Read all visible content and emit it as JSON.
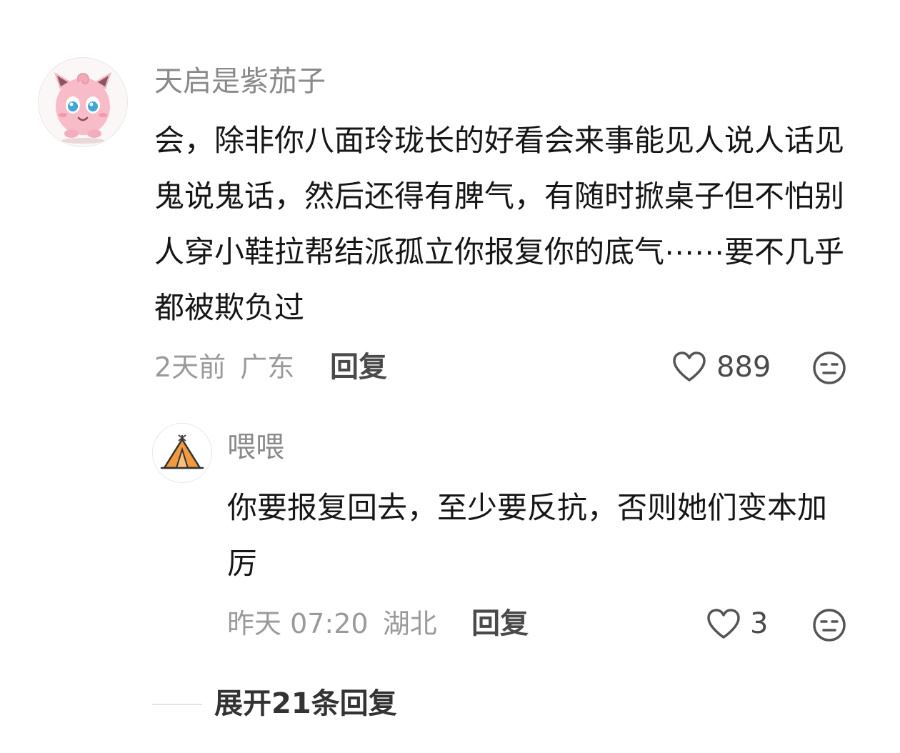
{
  "comment": {
    "username": "天启是紫茄子",
    "content": "会，除非你八面玲珑长的好看会来事能见人说人话见鬼说鬼话，然后还得有脾气，有随时掀桌子但不怕别人穿小鞋拉帮结派孤立你报复你的底气⋯⋯要不几乎都被欺负过",
    "time": "2天前",
    "location": "广东",
    "reply_label": "回复",
    "like_count": "889",
    "avatar_icon": "pink-jigglypuff-avatar",
    "like_icon": "heart-outline-icon",
    "emoji_icon": "neutral-face-icon"
  },
  "reply": {
    "username": "喂喂",
    "content": "你要报复回去，至少要反抗，否则她们变本加厉",
    "time": "昨天 07:20",
    "location": "湖北",
    "reply_label": "回复",
    "like_count": "3",
    "avatar_icon": "orange-tent-avatar",
    "like_icon": "heart-outline-icon",
    "emoji_icon": "neutral-face-icon"
  },
  "expand": {
    "label": "展开21条回复"
  },
  "colors": {
    "username": "#8a8a8a",
    "content": "#161616",
    "meta": "#9a9a9a",
    "accent_orange": "#f39a3e"
  }
}
